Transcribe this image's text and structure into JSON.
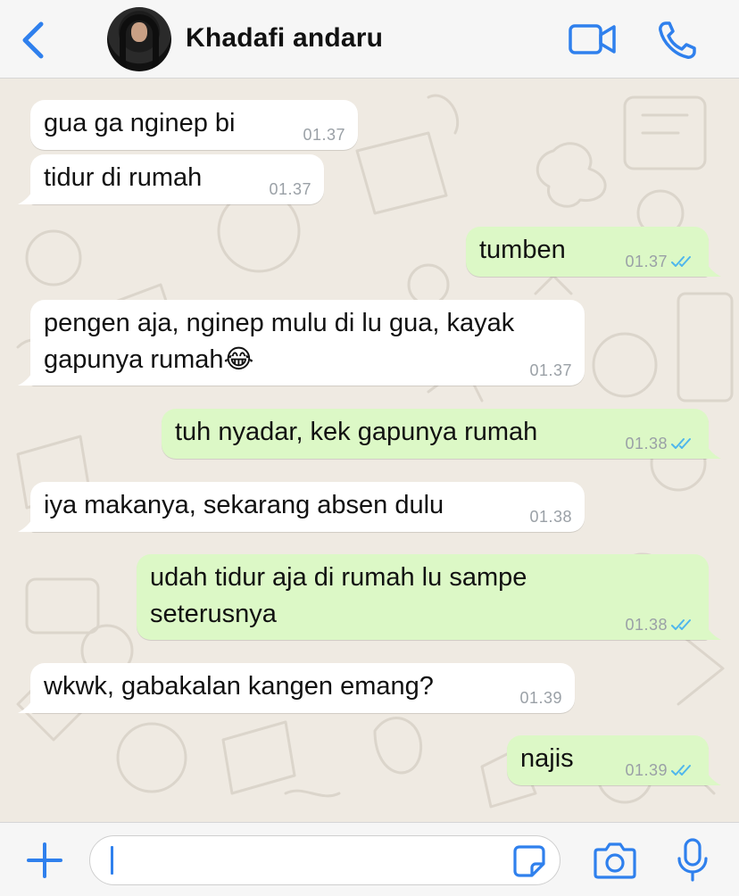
{
  "header": {
    "contact_name": "Khadafi andaru",
    "accent_color": "#2f80ed"
  },
  "messages": [
    {
      "direction": "in",
      "text": "gua ga nginep bi",
      "time": "01.37"
    },
    {
      "direction": "in",
      "text": "tidur di rumah",
      "time": "01.37"
    },
    {
      "direction": "out",
      "text": "tumben",
      "time": "01.37",
      "status": "read"
    },
    {
      "direction": "in",
      "text": "pengen aja, nginep mulu di lu gua, kayak\ngapunya rumah😂",
      "time": "01.37"
    },
    {
      "direction": "out",
      "text": "tuh nyadar, kek gapunya rumah",
      "time": "01.38",
      "status": "read"
    },
    {
      "direction": "in",
      "text": "iya makanya, sekarang absen dulu",
      "time": "01.38"
    },
    {
      "direction": "out",
      "text": "udah tidur aja di rumah lu sampe\nseterusnya",
      "time": "01.38",
      "status": "read"
    },
    {
      "direction": "in",
      "text": "wkwk, gabakalan kangen emang?",
      "time": "01.39"
    },
    {
      "direction": "out",
      "text": "najis",
      "time": "01.39",
      "status": "read"
    }
  ],
  "composer": {
    "input_value": ""
  },
  "icons": {
    "back": "chevron-left-icon",
    "video": "video-camera-icon",
    "call": "phone-icon",
    "plus": "plus-icon",
    "sticker": "sticker-icon",
    "camera": "camera-icon",
    "mic": "microphone-icon"
  },
  "colors": {
    "incoming_bubble": "#ffffff",
    "outgoing_bubble": "#dcf8c6",
    "chat_background": "#efeae2",
    "read_ticks": "#4fb6ec"
  }
}
